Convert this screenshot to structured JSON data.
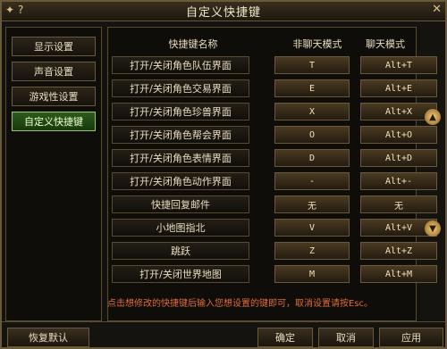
{
  "window": {
    "title": "自定义快捷键",
    "icons": [
      "settings-icon",
      "help-icon",
      "close-icon"
    ]
  },
  "sidebar": {
    "items": [
      {
        "label": "显示设置"
      },
      {
        "label": "声音设置"
      },
      {
        "label": "游戏性设置"
      },
      {
        "label": "自定义快捷键"
      }
    ]
  },
  "table": {
    "headers": [
      "快捷键名称",
      "非聊天模式",
      "聊天模式"
    ],
    "rows": [
      {
        "name": "打开/关闭角色队伍界面",
        "normal": "T",
        "chat": "Alt+T"
      },
      {
        "name": "打开/关闭角色交易界面",
        "normal": "E",
        "chat": "Alt+E"
      },
      {
        "name": "打开/关闭角色珍兽界面",
        "normal": "X",
        "chat": "Alt+X"
      },
      {
        "name": "打开/关闭角色帮会界面",
        "normal": "O",
        "chat": "Alt+O"
      },
      {
        "name": "打开/关闭角色表情界面",
        "normal": "D",
        "chat": "Alt+D"
      },
      {
        "name": "打开/关闭角色动作界面",
        "normal": "-",
        "chat": "Alt+-"
      },
      {
        "name": "快捷回复邮件",
        "normal": "无",
        "chat": "无"
      },
      {
        "name": "小地图指北",
        "normal": "V",
        "chat": "Alt+V"
      },
      {
        "name": "跳跃",
        "normal": "Z",
        "chat": "Alt+Z"
      },
      {
        "name": "打开/关闭世界地图",
        "normal": "M",
        "chat": "Alt+M"
      }
    ]
  },
  "note": "点击想修改的快捷键后输入您想设置的键即可，取消设置请按Esc。",
  "buttons": {
    "restore": "恢复默认",
    "ok": "确定",
    "cancel": "取消",
    "apply": "应用"
  }
}
